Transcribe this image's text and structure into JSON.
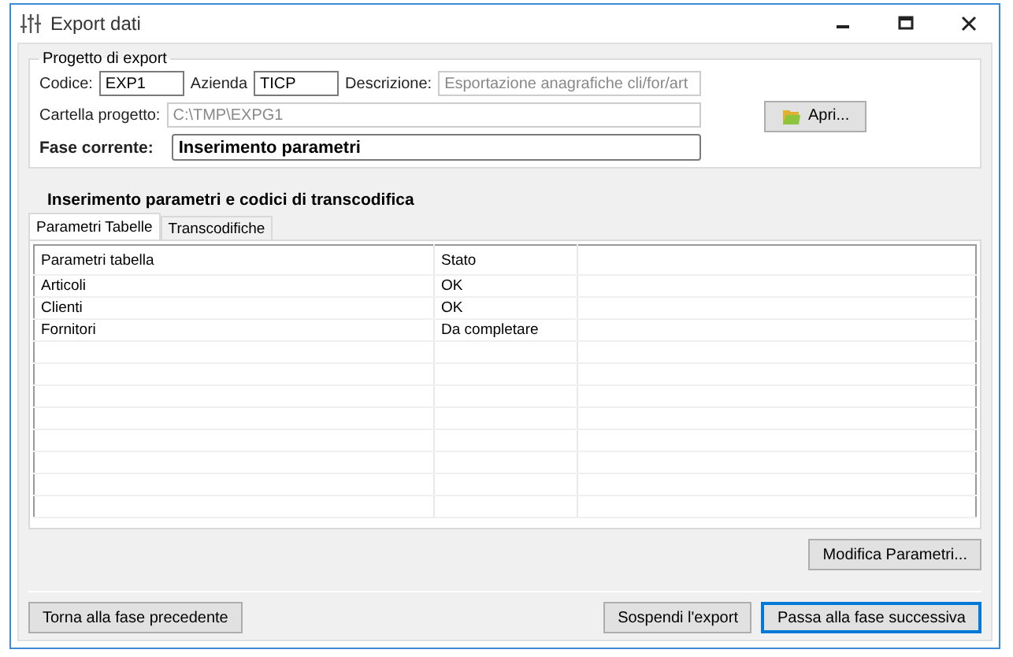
{
  "window": {
    "title": "Export dati"
  },
  "project": {
    "legend": "Progetto di export",
    "code": {
      "label": "Codice:",
      "value": "EXP1",
      "disabled": false
    },
    "company": {
      "label": "Azienda",
      "value": "TICP",
      "disabled": false
    },
    "description": {
      "label": "Descrizione:",
      "value": "Esportazione anagrafiche cli/for/art",
      "disabled": true
    },
    "folder": {
      "label": "Cartella progetto:",
      "value": "C:\\TMP\\EXPG1",
      "disabled": true
    },
    "open_button": "Apri...",
    "phase": {
      "label": "Fase corrente:",
      "value": "Inserimento parametri"
    }
  },
  "section_title": "Inserimento parametri e codici di transcodifica",
  "tabs": [
    {
      "label": "Parametri Tabelle",
      "selected": true
    },
    {
      "label": "Transcodifiche",
      "selected": false
    }
  ],
  "table": {
    "columns": [
      "Parametri tabella",
      "Stato"
    ],
    "rows": [
      [
        "Articoli",
        "OK"
      ],
      [
        "Clienti",
        "OK"
      ],
      [
        "Fornitori",
        "Da completare"
      ]
    ]
  },
  "modify_button": "Modifica Parametri...",
  "buttons": [
    {
      "label": "Torna alla fase precedente",
      "default": false
    },
    {
      "label": "Sospendi l'export",
      "default": false
    },
    {
      "label": "Passa alla fase successiva",
      "default": true
    }
  ]
}
